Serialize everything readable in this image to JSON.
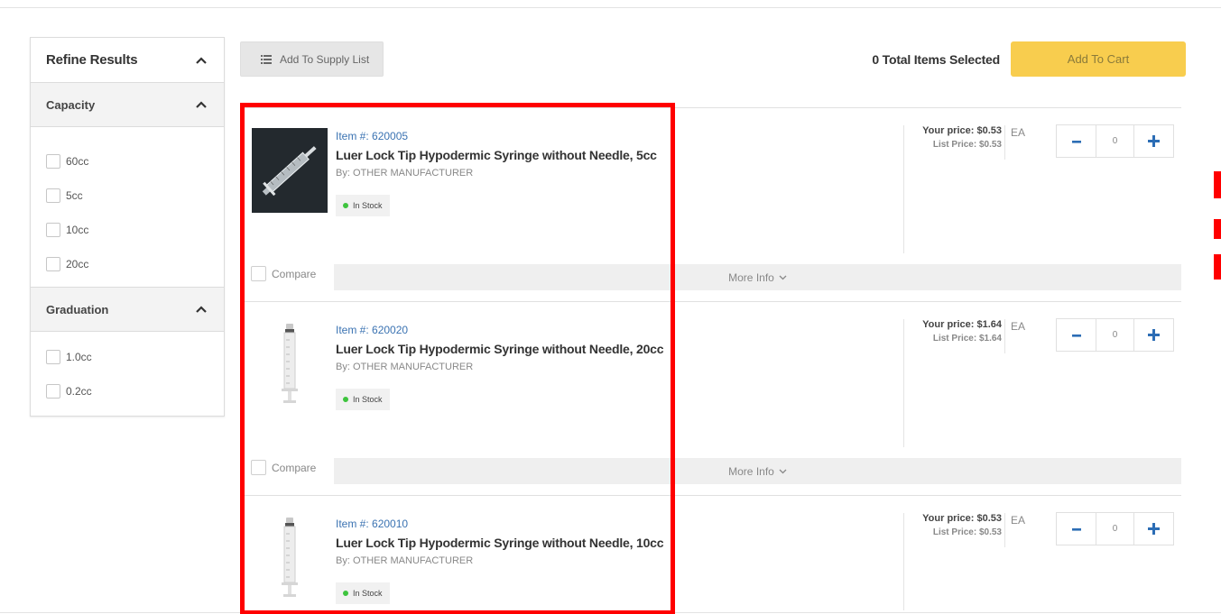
{
  "sidebar": {
    "title": "Refine Results",
    "facets": [
      {
        "title": "Capacity",
        "options": [
          "60cc",
          "5cc",
          "10cc",
          "20cc"
        ]
      },
      {
        "title": "Graduation",
        "options": [
          "1.0cc",
          "0.2cc"
        ]
      }
    ]
  },
  "toolbar": {
    "supply_list_label": "Add To Supply List",
    "total_selected": "0 Total Items Selected",
    "add_to_cart_label": "Add To Cart"
  },
  "products": [
    {
      "item_number": "Item #: 620005",
      "name": "Luer Lock Tip Hypodermic Syringe without Needle, 5cc",
      "manufacturer": "By: OTHER MANUFACTURER",
      "stock": "In Stock",
      "your_price": "Your price:  $0.53",
      "list_price": "List Price: $0.53",
      "uom": "EA",
      "quantity": "0",
      "compare_label": "Compare",
      "more_info_label": "More Info"
    },
    {
      "item_number": "Item #: 620020",
      "name": "Luer Lock Tip Hypodermic Syringe without Needle, 20cc",
      "manufacturer": "By: OTHER MANUFACTURER",
      "stock": "In Stock",
      "your_price": "Your price:  $1.64",
      "list_price": "List Price: $1.64",
      "uom": "EA",
      "quantity": "0",
      "compare_label": "Compare",
      "more_info_label": "More Info"
    },
    {
      "item_number": "Item #: 620010",
      "name": "Luer Lock Tip Hypodermic Syringe without Needle, 10cc",
      "manufacturer": "By: OTHER MANUFACTURER",
      "stock": "In Stock",
      "your_price": "Your price:  $0.53",
      "list_price": "List Price: $0.53",
      "uom": "EA",
      "quantity": "0",
      "compare_label": "Compare",
      "more_info_label": "More Info"
    }
  ],
  "colors": {
    "accent_blue": "#2c6db5",
    "item_link": "#3b73b2",
    "cart_yellow": "#f8cd4e",
    "stock_green": "#3ec43e",
    "highlight_red": "#ff0000"
  }
}
